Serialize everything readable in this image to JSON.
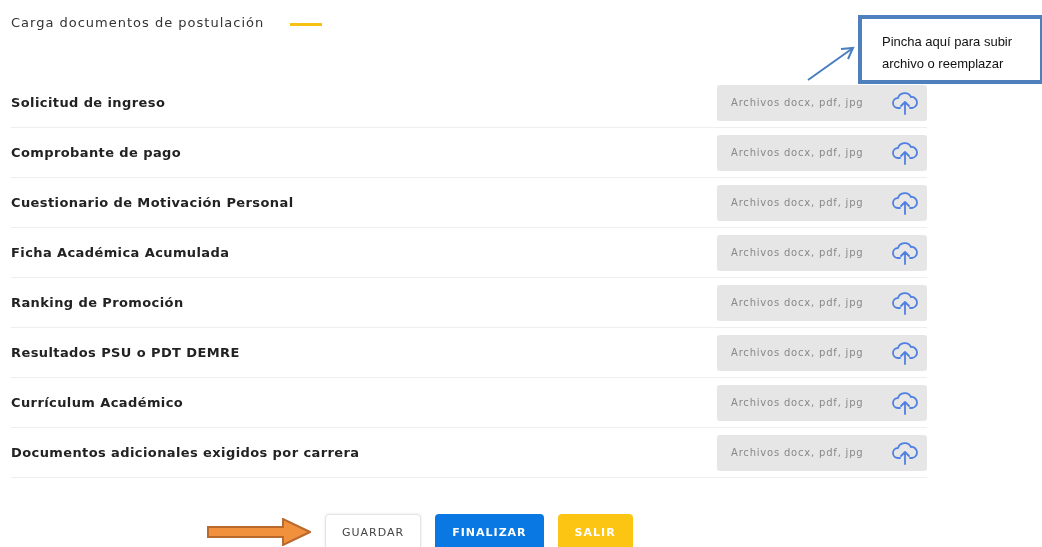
{
  "section_title": "Carga documentos de postulación",
  "documents": [
    {
      "label": "Solicitud de ingreso",
      "placeholder": "Archivos docx, pdf, jpg"
    },
    {
      "label": "Comprobante de pago",
      "placeholder": "Archivos docx, pdf, jpg"
    },
    {
      "label": "Cuestionario de Motivación Personal",
      "placeholder": "Archivos docx, pdf, jpg"
    },
    {
      "label": "Ficha Académica Acumulada",
      "placeholder": "Archivos docx, pdf, jpg"
    },
    {
      "label": "Ranking de Promoción",
      "placeholder": "Archivos docx, pdf, jpg"
    },
    {
      "label": "Resultados PSU o PDT DEMRE",
      "placeholder": "Archivos docx, pdf, jpg"
    },
    {
      "label": "Currículum Académico",
      "placeholder": "Archivos docx, pdf, jpg"
    },
    {
      "label": "Documentos adicionales exigidos por carrera",
      "placeholder": "Archivos docx, pdf, jpg"
    }
  ],
  "callout": {
    "text": "Pincha aquí para subir archivo o reemplazar"
  },
  "buttons": [
    {
      "label": "GUARDAR",
      "kind": "outline"
    },
    {
      "label": "FINALIZAR",
      "kind": "primary"
    },
    {
      "label": "SALIR",
      "kind": "warning"
    }
  ]
}
